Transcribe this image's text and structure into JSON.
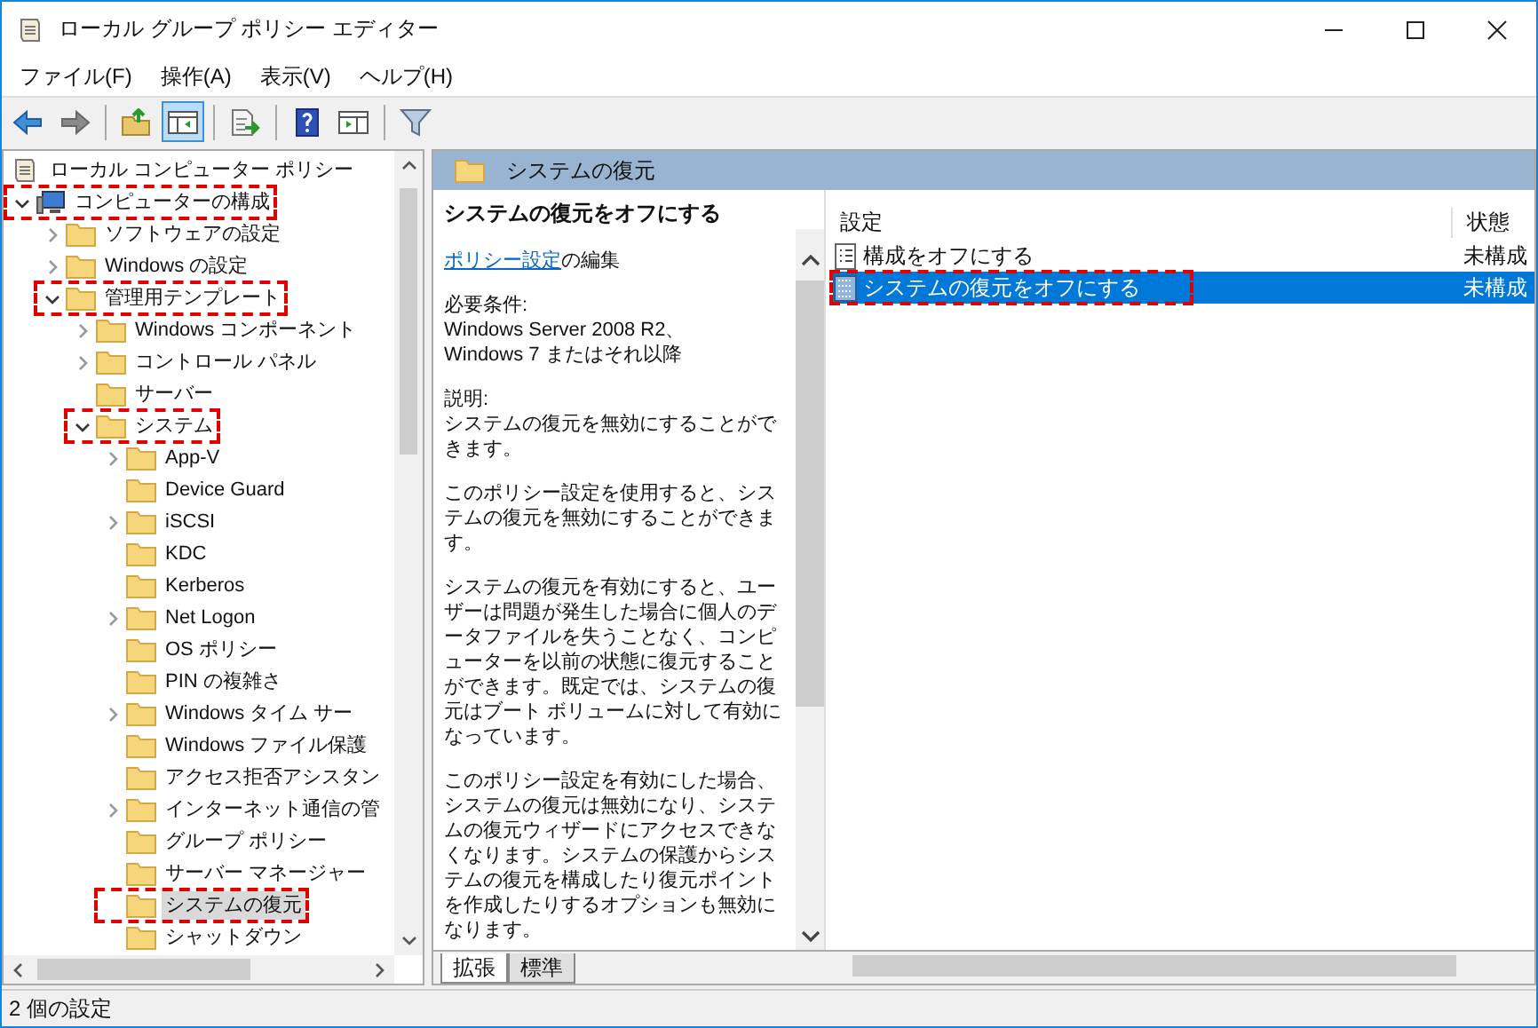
{
  "window": {
    "title": "ローカル グループ ポリシー エディター"
  },
  "menu": [
    "ファイル(F)",
    "操作(A)",
    "表示(V)",
    "ヘルプ(H)"
  ],
  "toolbar": [
    [
      {
        "kind": "back",
        "selected": false
      },
      {
        "kind": "forward",
        "selected": false
      }
    ],
    [
      {
        "kind": "up",
        "selected": false
      },
      {
        "kind": "tree",
        "selected": true
      }
    ],
    [
      {
        "kind": "export",
        "selected": false
      }
    ],
    [
      {
        "kind": "help",
        "selected": false
      },
      {
        "kind": "action",
        "selected": false
      }
    ],
    [
      {
        "kind": "filter",
        "selected": false
      }
    ]
  ],
  "tree": {
    "label": "ローカル コンピューター ポリシー",
    "kind": "policy",
    "selected": false,
    "children": [
      {
        "label": "コンピューターの構成",
        "kind": "computer",
        "selected": false,
        "highlighted": true,
        "expandable": true,
        "expanded": true,
        "children": [
          {
            "label": "ソフトウェアの設定",
            "kind": "folder",
            "selected": false,
            "highlighted": false,
            "expandable": true,
            "expanded": false
          },
          {
            "label": "Windows の設定",
            "kind": "folder",
            "selected": false,
            "highlighted": false,
            "expandable": true,
            "expanded": false
          },
          {
            "label": "管理用テンプレート",
            "kind": "folder",
            "selected": false,
            "highlighted": true,
            "expandable": true,
            "expanded": true,
            "children": [
              {
                "label": "Windows コンポーネント",
                "kind": "folder",
                "selected": false,
                "highlighted": false,
                "expandable": true,
                "expanded": false
              },
              {
                "label": "コントロール パネル",
                "kind": "folder",
                "selected": false,
                "highlighted": false,
                "expandable": true,
                "expanded": false
              },
              {
                "label": "サーバー",
                "kind": "folder",
                "selected": false,
                "highlighted": false,
                "expandable": false,
                "expanded": false
              },
              {
                "label": "システム",
                "kind": "folder",
                "selected": false,
                "highlighted": true,
                "expandable": true,
                "expanded": true,
                "children": [
                  {
                    "label": "App-V",
                    "kind": "folder",
                    "selected": false,
                    "highlighted": false,
                    "expandable": true,
                    "expanded": false
                  },
                  {
                    "label": "Device Guard",
                    "kind": "folder",
                    "selected": false,
                    "highlighted": false,
                    "expandable": false,
                    "expanded": false
                  },
                  {
                    "label": "iSCSI",
                    "kind": "folder",
                    "selected": false,
                    "highlighted": false,
                    "expandable": true,
                    "expanded": false
                  },
                  {
                    "label": "KDC",
                    "kind": "folder",
                    "selected": false,
                    "highlighted": false,
                    "expandable": false,
                    "expanded": false
                  },
                  {
                    "label": "Kerberos",
                    "kind": "folder",
                    "selected": false,
                    "highlighted": false,
                    "expandable": false,
                    "expanded": false
                  },
                  {
                    "label": "Net Logon",
                    "kind": "folder",
                    "selected": false,
                    "highlighted": false,
                    "expandable": true,
                    "expanded": false
                  },
                  {
                    "label": "OS ポリシー",
                    "kind": "folder",
                    "selected": false,
                    "highlighted": false,
                    "expandable": false,
                    "expanded": false
                  },
                  {
                    "label": "PIN の複雑さ",
                    "kind": "folder",
                    "selected": false,
                    "highlighted": false,
                    "expandable": false,
                    "expanded": false
                  },
                  {
                    "label": "Windows タイム サー",
                    "kind": "folder",
                    "selected": false,
                    "highlighted": false,
                    "expandable": true,
                    "expanded": false
                  },
                  {
                    "label": "Windows ファイル保護",
                    "kind": "folder",
                    "selected": false,
                    "highlighted": false,
                    "expandable": false,
                    "expanded": false
                  },
                  {
                    "label": "アクセス拒否アシスタン",
                    "kind": "folder",
                    "selected": false,
                    "highlighted": false,
                    "expandable": false,
                    "expanded": false
                  },
                  {
                    "label": "インターネット通信の管",
                    "kind": "folder",
                    "selected": false,
                    "highlighted": false,
                    "expandable": true,
                    "expanded": false
                  },
                  {
                    "label": "グループ ポリシー",
                    "kind": "folder",
                    "selected": false,
                    "highlighted": false,
                    "expandable": false,
                    "expanded": false
                  },
                  {
                    "label": "サーバー マネージャー",
                    "kind": "folder",
                    "selected": false,
                    "highlighted": false,
                    "expandable": false,
                    "expanded": false
                  },
                  {
                    "label": "システムの復元",
                    "kind": "folder",
                    "selected": true,
                    "highlighted": true,
                    "expandable": false,
                    "expanded": false
                  },
                  {
                    "label": "シャットダウン",
                    "kind": "folder",
                    "selected": false,
                    "highlighted": false,
                    "expandable": false,
                    "expanded": false
                  }
                ]
              }
            ]
          }
        ]
      }
    ]
  },
  "header": {
    "title": "システムの復元"
  },
  "description": {
    "title": "システムの復元をオフにする",
    "link": "ポリシー設定",
    "link_suffix": "の編集",
    "paragraphs": [
      [
        "必要条件:",
        "Windows Server 2008 R2、",
        "Windows 7 またはそれ以降"
      ],
      [
        "説明:",
        "システムの復元を無効にすることができます。"
      ],
      [
        "このポリシー設定を使用すると、システムの復元を無効にすることができます。"
      ],
      [
        "システムの復元を有効にすると、ユーザーは問題が発生した場合に個人のデータファイルを失うことなく、コンピューターを以前の状態に復元することができます。既定では、システムの復元はブート ボリュームに対して有効になっています。"
      ],
      [
        "このポリシー設定を有効にした場合、システムの復元は無効になり、システムの復元ウィザードにアクセスできなくなります。システムの保護からシステムの復元を構成したり復元ポイントを作成したりするオプションも無効になります。"
      ]
    ]
  },
  "list": {
    "columns": [
      "設定",
      "状態"
    ],
    "rows": [
      {
        "name": "構成をオフにする",
        "state": "未構成",
        "kind": "setting",
        "selected": false,
        "highlighted": false
      },
      {
        "name": "システムの復元をオフにする",
        "state": "未構成",
        "kind": "policy",
        "selected": true,
        "highlighted": true
      }
    ]
  },
  "tabs": [
    {
      "label": "拡張",
      "selected": true
    },
    {
      "label": "標準",
      "selected": false
    }
  ],
  "status_bar": "2 個の設定"
}
